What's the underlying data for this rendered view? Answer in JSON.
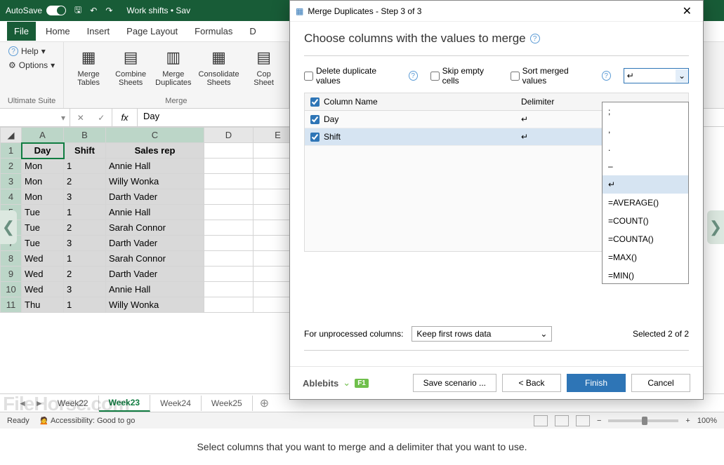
{
  "titlebar": {
    "autosave": "AutoSave",
    "toggle_state": "On",
    "doc_title": "Work shifts • Sav"
  },
  "tabs": {
    "file": "File",
    "home": "Home",
    "insert": "Insert",
    "page_layout": "Page Layout",
    "formulas": "Formulas",
    "d": "D"
  },
  "ribbon": {
    "group1_label": "Ultimate Suite",
    "help": "Help",
    "options": "Options",
    "group2_label": "Merge",
    "btns": {
      "merge_tables": "Merge\nTables",
      "combine_sheets": "Combine\nSheets",
      "merge_duplicates": "Merge\nDuplicates",
      "consolidate_sheets": "Consolidate\nSheets",
      "copy_sheets": "Cop\nSheet"
    }
  },
  "namebox": "",
  "fx_value": "Day",
  "columns": [
    "A",
    "B",
    "C",
    "D",
    "E"
  ],
  "headers": {
    "A": "Day",
    "B": "Shift",
    "C": "Sales rep"
  },
  "rows": [
    {
      "n": 1
    },
    {
      "n": 2,
      "A": "Mon",
      "B": "1",
      "C": "Annie Hall"
    },
    {
      "n": 3,
      "A": "Mon",
      "B": "2",
      "C": "Willy Wonka"
    },
    {
      "n": 4,
      "A": "Mon",
      "B": "3",
      "C": "Darth Vader"
    },
    {
      "n": 5,
      "A": "Tue",
      "B": "1",
      "C": "Annie Hall"
    },
    {
      "n": 6,
      "A": "Tue",
      "B": "2",
      "C": "Sarah Connor"
    },
    {
      "n": 7,
      "A": "Tue",
      "B": "3",
      "C": "Darth Vader"
    },
    {
      "n": 8,
      "A": "Wed",
      "B": "1",
      "C": "Sarah Connor"
    },
    {
      "n": 9,
      "A": "Wed",
      "B": "2",
      "C": "Darth Vader"
    },
    {
      "n": 10,
      "A": "Wed",
      "B": "3",
      "C": "Annie Hall"
    },
    {
      "n": 11,
      "A": "Thu",
      "B": "1",
      "C": "Willy Wonka"
    }
  ],
  "sheets": {
    "s1": "Week22",
    "s2": "Week23",
    "s3": "Week24",
    "s4": "Week25"
  },
  "status": {
    "ready": "Ready",
    "access": "Accessibility: Good to go",
    "zoom": "100%"
  },
  "caption": "Select columns that you want to merge and a delimiter that you want to use.",
  "dialog": {
    "title": "Merge Duplicates - Step 3 of 3",
    "heading": "Choose columns with the values to merge",
    "opt_delete": "Delete duplicate values",
    "opt_skip": "Skip empty cells",
    "opt_sort": "Sort merged values",
    "combo_value": "↵",
    "col_header_name": "Column Name",
    "col_header_delim": "Delimiter",
    "cols": [
      {
        "name": "Day",
        "delim": "↵",
        "sel": false
      },
      {
        "name": "Shift",
        "delim": "↵",
        "sel": true
      }
    ],
    "unprocessed_label": "For unprocessed columns:",
    "unprocessed_value": "Keep first rows data",
    "selected": "Selected 2 of 2",
    "brand": "Ablebits",
    "btn_save": "Save scenario ...",
    "btn_back": "<  Back",
    "btn_finish": "Finish",
    "btn_cancel": "Cancel",
    "dropdown": [
      ";",
      ",",
      ".",
      "–",
      "↵",
      "=AVERAGE()",
      "=COUNT()",
      "=COUNTA()",
      "=MAX()",
      "=MIN()"
    ]
  }
}
